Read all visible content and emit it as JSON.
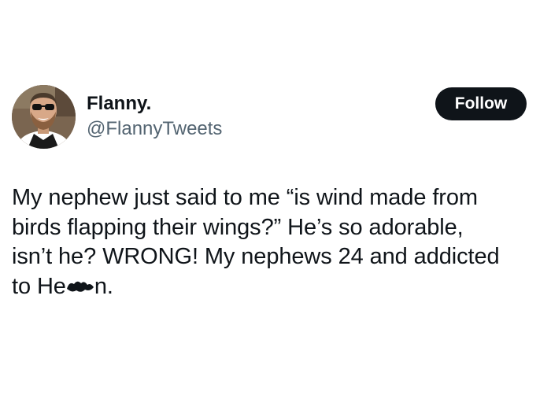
{
  "post": {
    "author": {
      "display_name": "Flanny.",
      "handle": "@FlannyTweets",
      "avatar_icon": "avatar-photo"
    },
    "follow_label": "Follow",
    "text_lines": [
      "My nephew just said to me “is wind made from",
      "birds flapping their wings?” He’s so adorable,",
      "isn’t he? WRONG! My nephews 24 and addicted"
    ],
    "last_line_prefix": "to He",
    "last_line_suffix": "n.",
    "redaction": "scribble-redaction-icon"
  },
  "colors": {
    "text": "#0f1419",
    "secondary_text": "#536471",
    "follow_button_bg": "#0f1419",
    "follow_button_text": "#ffffff",
    "background": "#ffffff"
  }
}
